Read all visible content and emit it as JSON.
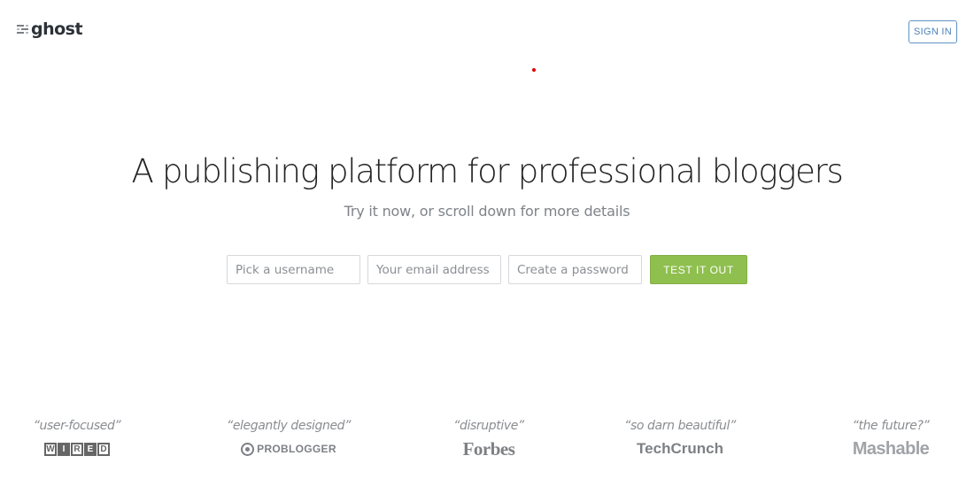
{
  "header": {
    "logo_text": "ghost",
    "logo_icon": "ghost-lines-icon",
    "signin_label": "SIGN IN"
  },
  "hero": {
    "title": "A publishing platform for professional bloggers",
    "subtitle": "Try it now, or scroll down for more details"
  },
  "signup": {
    "username_placeholder": "Pick a username",
    "email_placeholder": "Your email address",
    "password_placeholder": "Create a password",
    "username_value": "",
    "email_value": "",
    "password_value": "",
    "submit_label": "TEST IT OUT"
  },
  "press": [
    {
      "quote": "“user-focused”",
      "source": "WIRED"
    },
    {
      "quote": "“elegantly designed”",
      "source": "PROBLOGGER"
    },
    {
      "quote": "“disruptive”",
      "source": "Forbes"
    },
    {
      "quote": "“so darn beautiful”",
      "source": "TechCrunch"
    },
    {
      "quote": "“the future?”",
      "source": "Mashable"
    }
  ],
  "colors": {
    "accent_green": "#8fbf4f",
    "signin_blue": "#4a82b8",
    "title_text": "#222222",
    "muted_text": "#7f8389"
  }
}
